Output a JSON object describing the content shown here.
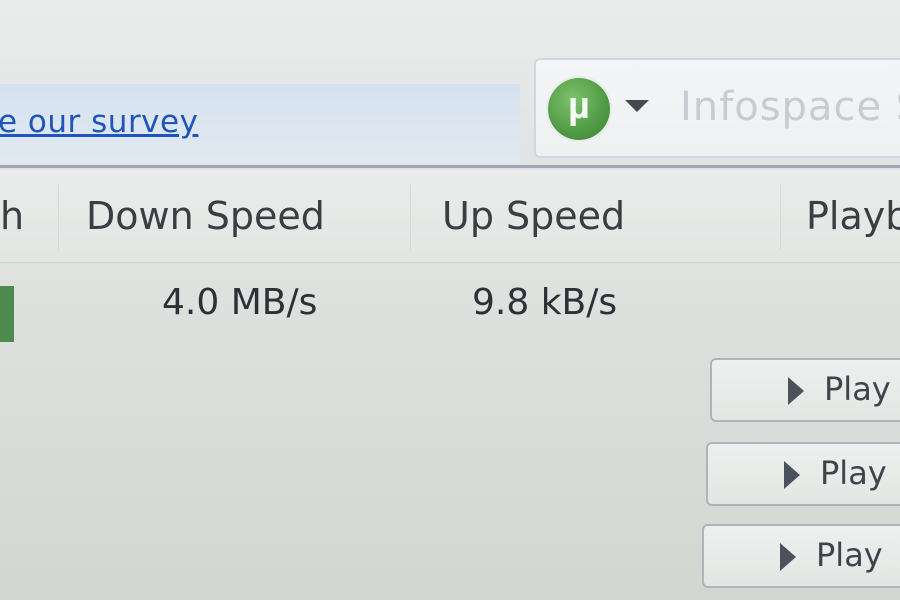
{
  "toolbar": {
    "survey_link": "e our survey",
    "search_logo_letter": "µ",
    "search_placeholder": "Infospace S"
  },
  "columns": {
    "partial_left": "h",
    "down_speed": "Down Speed",
    "up_speed": "Up Speed",
    "playback": "Playb"
  },
  "row": {
    "down_speed": "4.0 MB/s",
    "up_speed": "9.8 kB/s"
  },
  "play_buttons": [
    {
      "label": "Play"
    },
    {
      "label": "Play"
    },
    {
      "label": "Play"
    }
  ],
  "colors": {
    "link": "#1f55b8",
    "logo_green": "#4f9a44",
    "progress_green": "#4f8a4f"
  },
  "icons": [
    "utorrent-logo-icon",
    "chevron-down-icon",
    "play-icon"
  ]
}
